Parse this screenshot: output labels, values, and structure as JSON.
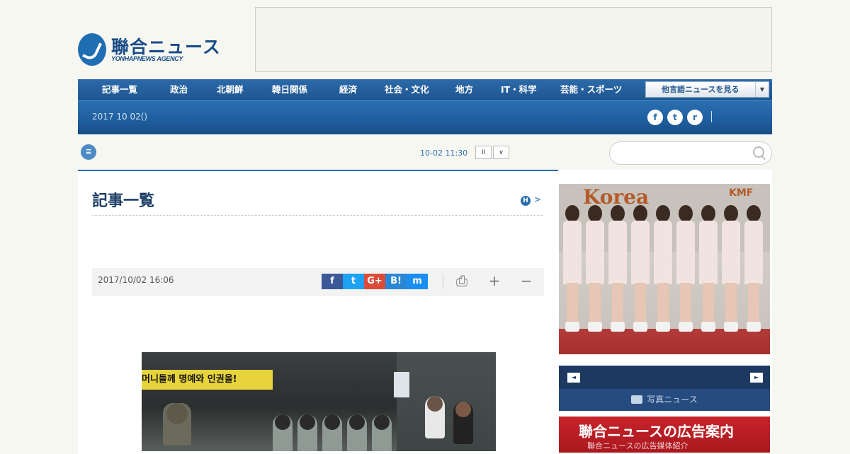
{
  "logo": {
    "jp": "聯合ニュース",
    "en": "YONHAPNEWS AGENCY"
  },
  "nav": {
    "items": [
      "記事一覧",
      "政治",
      "北朝鮮",
      "韓日関係",
      "経済",
      "社会・文化",
      "地方",
      "IT・科学",
      "芸能・スポーツ"
    ],
    "lang_select": "他言語ニュースを見る",
    "date": "2017 10 02()"
  },
  "social": {
    "facebook": "f",
    "twitter": "t",
    "rss": "r"
  },
  "ticker": {
    "time": "10-02 11:30",
    "pause": "II",
    "next": "∨"
  },
  "search": {
    "placeholder": ""
  },
  "main": {
    "title": "記事一覧",
    "h_badge": "H",
    "more": ">",
    "article_date": "2017/10/02 16:06",
    "share": {
      "fb": "f",
      "tw": "t",
      "gp": "G+",
      "hb": "B!",
      "msg": "m"
    },
    "tools": {
      "print": "⎙",
      "plus": "+",
      "minus": "−"
    },
    "photo_banner_text": "머니들께 명예와 인권을!"
  },
  "right": {
    "feature_text_1": "Korea",
    "feature_text_2": "KMF",
    "photo_news_label": "写真ニュース",
    "prev": "◄",
    "next": "►",
    "ad_title": "聯合ニュースの広告案内",
    "ad_sub": "聯合ニュースの広告媒体紹介"
  },
  "colors": {
    "brand": "#1f5e9e",
    "accent": "#2a6fb0",
    "ad_red": "#c7242b"
  }
}
